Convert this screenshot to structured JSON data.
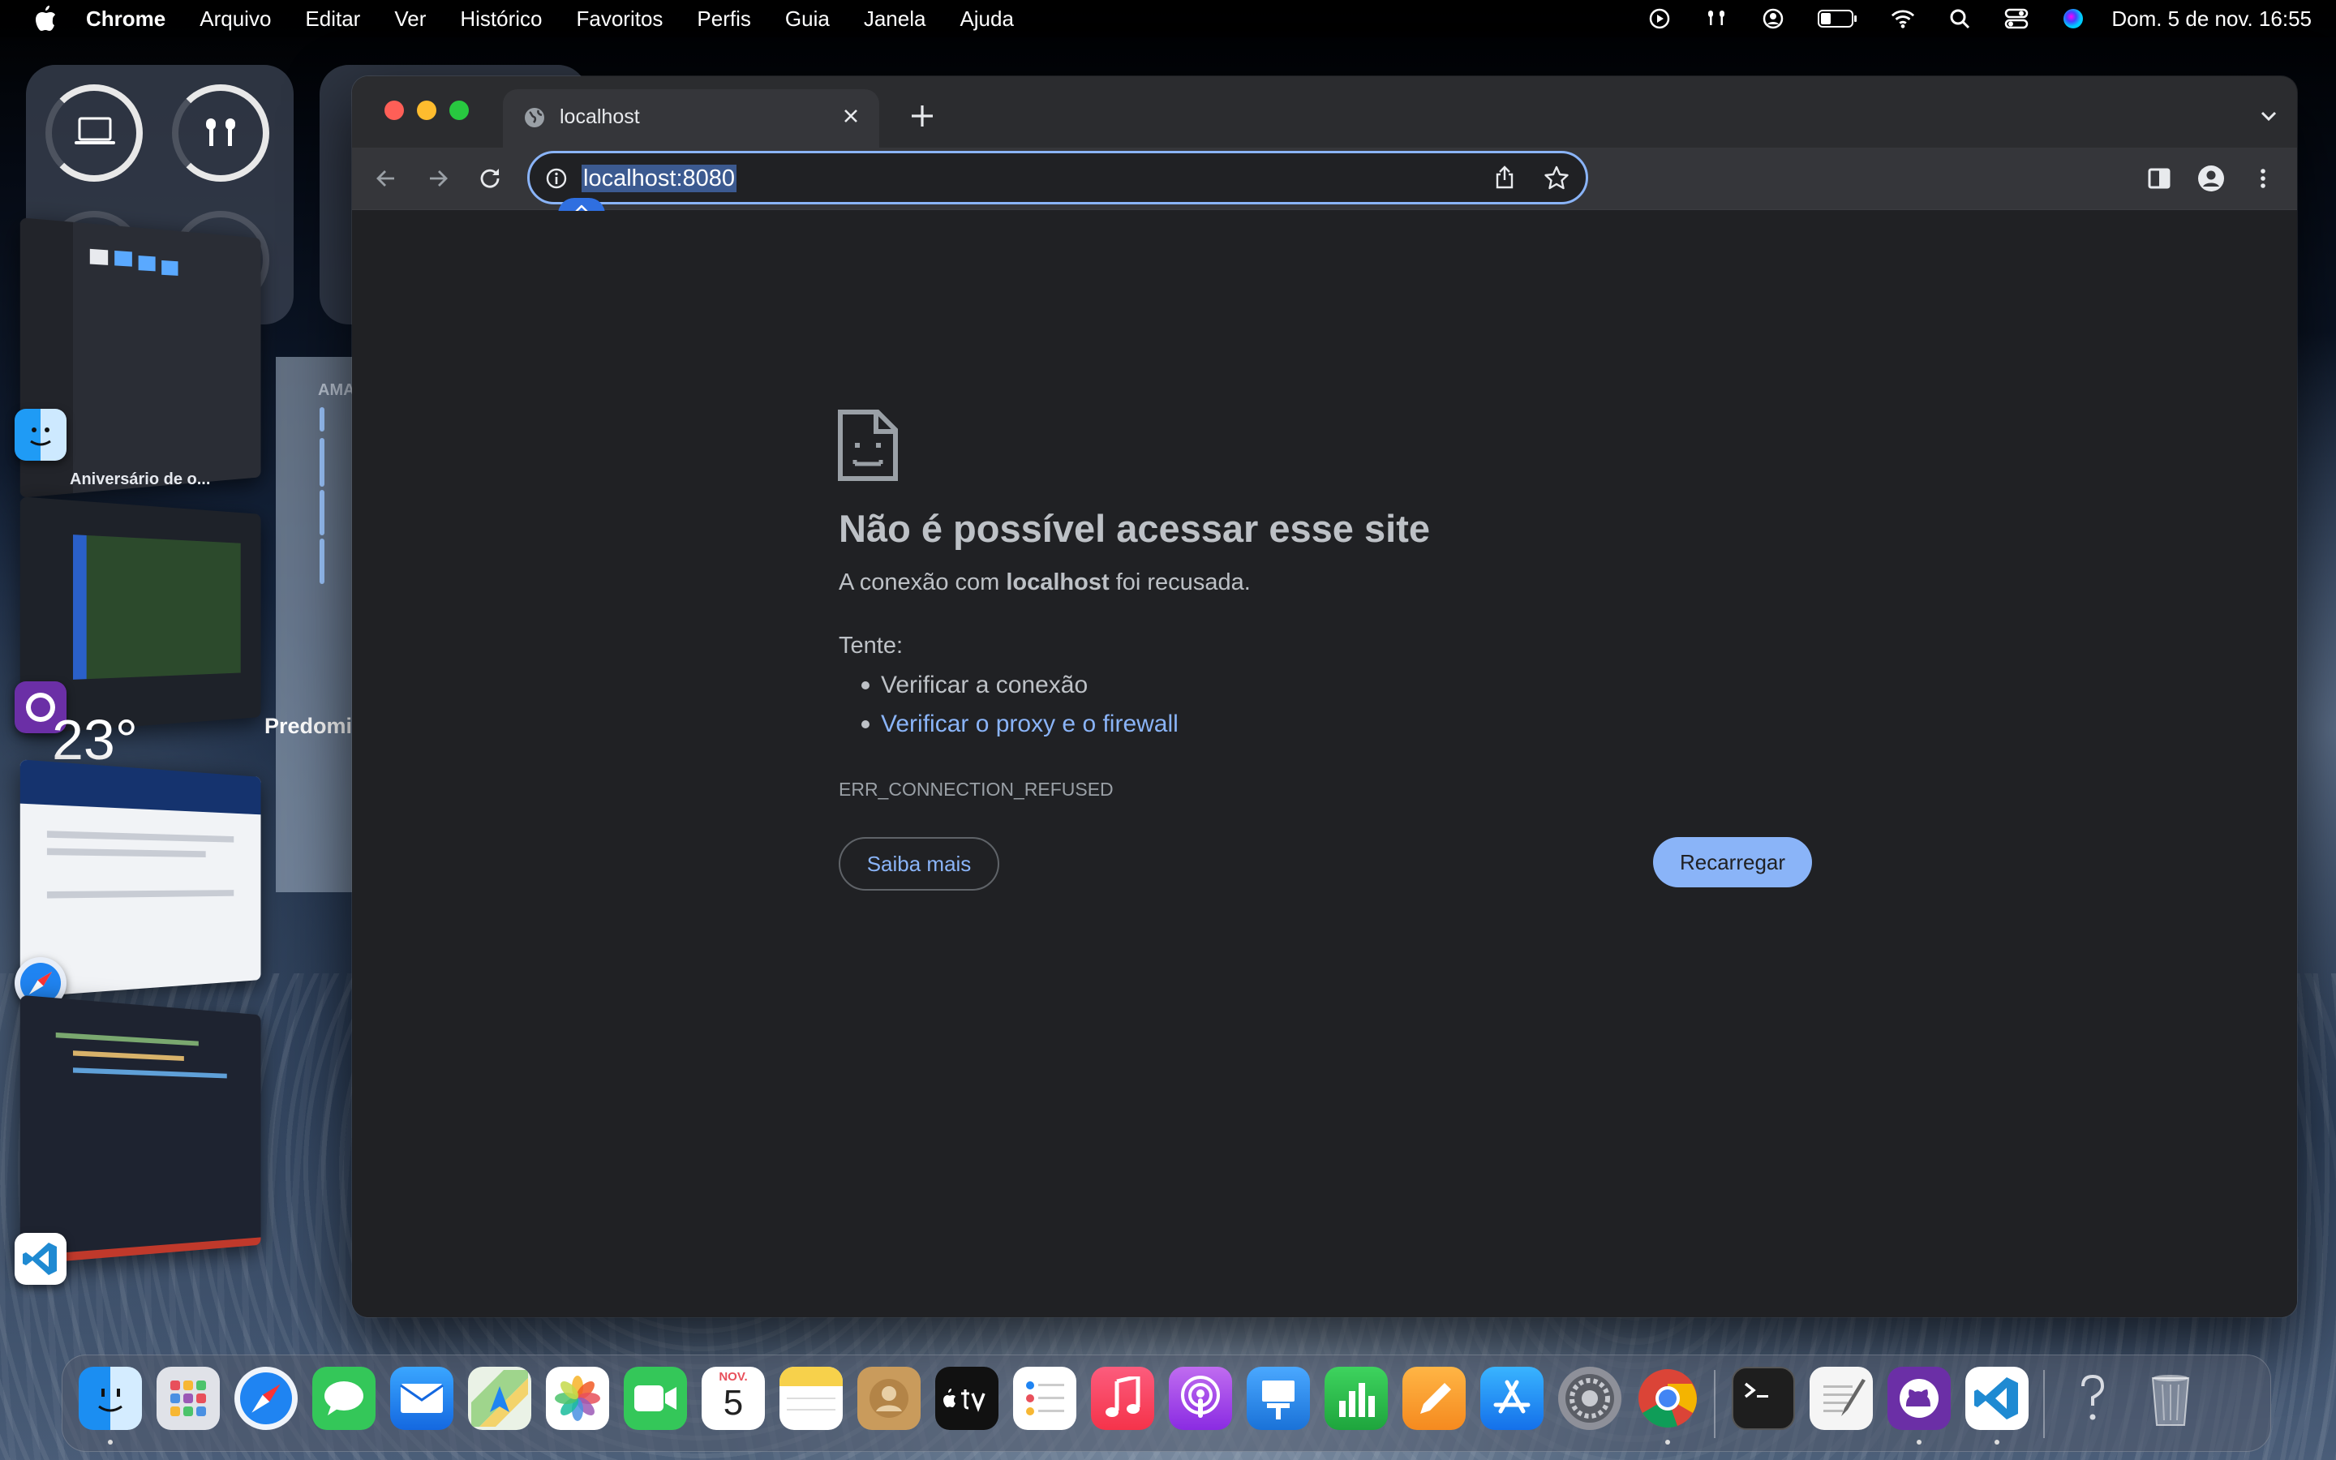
{
  "menubar": {
    "app_name": "Chrome",
    "menus": [
      "Arquivo",
      "Editar",
      "Ver",
      "Histórico",
      "Favoritos",
      "Perfis",
      "Guia",
      "Janela",
      "Ajuda"
    ],
    "clock": "Dom. 5 de nov.  16:55",
    "status_icons": [
      "play-circle-icon",
      "airpods-icon",
      "user-circle-icon",
      "battery-icon",
      "wifi-icon",
      "search-icon",
      "control-center-icon",
      "siri-icon"
    ]
  },
  "desktop": {
    "stage_label": "Aniversário de o...",
    "weather_temp": "23°",
    "weather_desc": "Predomin",
    "calendar_header": "AMA"
  },
  "browser": {
    "tab_title": "localhost",
    "url": "localhost:8080"
  },
  "error": {
    "heading": "Não é possível acessar esse site",
    "summary_prefix": "A conexão com ",
    "summary_host": "localhost",
    "summary_suffix": " foi recusada.",
    "try_label": "Tente:",
    "suggestions": [
      "Verificar a conexão",
      "Verificar o proxy e o firewall"
    ],
    "code": "ERR_CONNECTION_REFUSED",
    "learn_more": "Saiba mais",
    "reload": "Recarregar"
  },
  "dock": {
    "calendar_month": "NOV.",
    "calendar_day": "5",
    "apps": [
      "Finder",
      "Launchpad",
      "Safari",
      "Messages",
      "Mail",
      "Maps",
      "Photos",
      "FaceTime",
      "Calendar",
      "Notes",
      "Contacts",
      "TV",
      "Reminders",
      "Music",
      "Podcasts",
      "Keynote",
      "Numbers",
      "Pages",
      "App Store",
      "System Settings",
      "Chrome",
      "Terminal",
      "TextEdit",
      "GitHub Desktop",
      "VS Code",
      "Help",
      "Trash"
    ]
  },
  "colors": {
    "accent": "#8ab4f8",
    "page_background": "#202124",
    "text": "#bdc1c6"
  }
}
